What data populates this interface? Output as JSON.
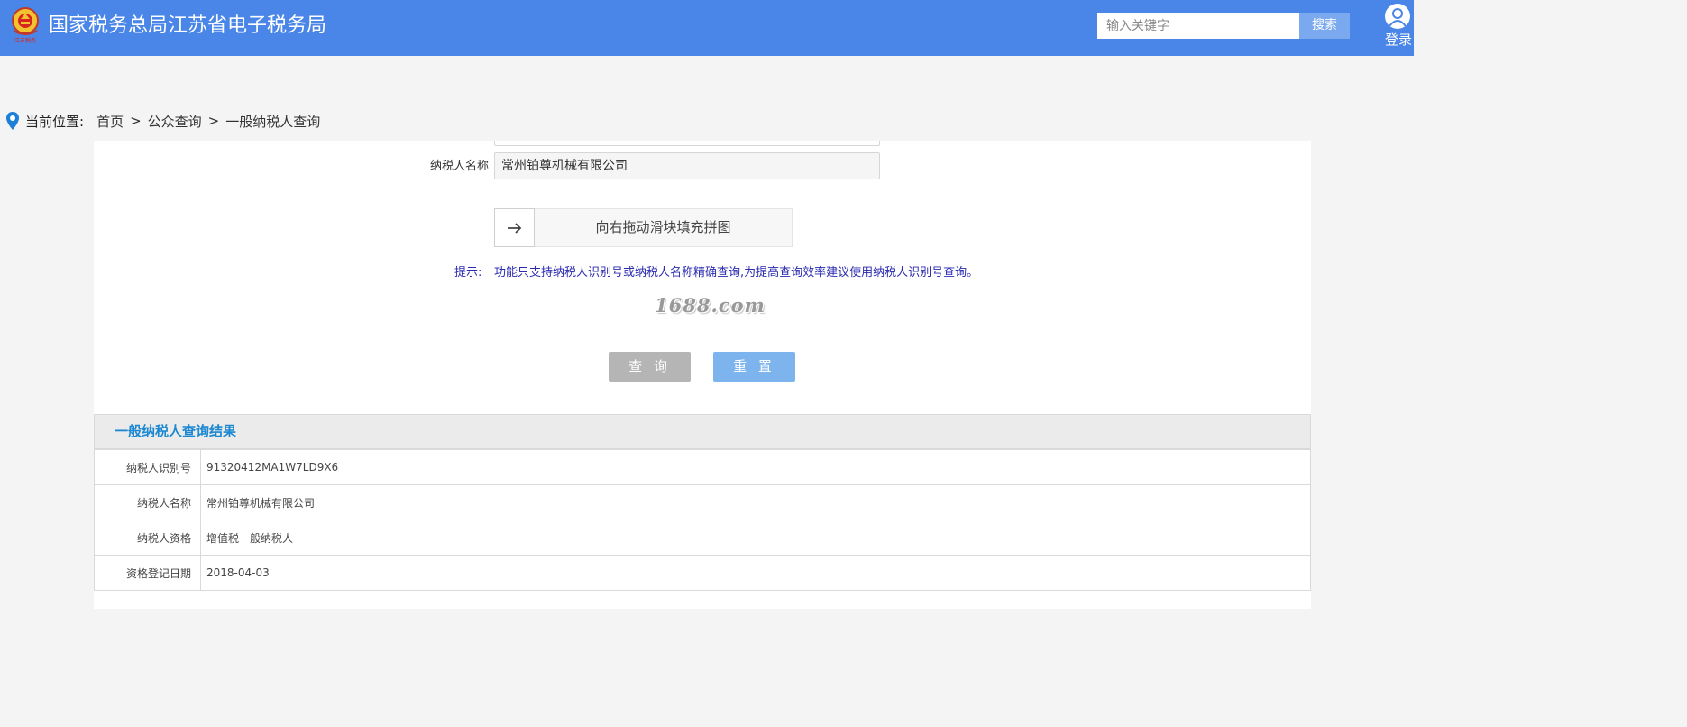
{
  "header": {
    "site_title": "国家税务总局江苏省电子税务局",
    "logo_text": "江苏税务",
    "search_placeholder": "输入关键字",
    "search_button": "搜索",
    "login_label": "登录",
    "bar_color": "#4a86e8"
  },
  "breadcrumb": {
    "lead": "当前位置:",
    "items": [
      "首页",
      "公众查询",
      "一般纳税人查询"
    ],
    "separator": ">"
  },
  "form": {
    "taxpayer_name_label": "纳税人名称",
    "taxpayer_name_value": "常州铂尊机械有限公司",
    "slider_text": "向右拖动滑块填充拼图",
    "tip_label": "提示:",
    "tip_text": "功能只支持纳税人识别号或纳税人名称精确查询,为提高查询效率建议使用纳税人识别号查询。",
    "watermark": "1688.com",
    "query_button": "查 询",
    "reset_button": "重 置"
  },
  "result": {
    "title": "一般纳税人查询结果",
    "rows": [
      {
        "label": "纳税人识别号",
        "value": "91320412MA1W7LD9X6"
      },
      {
        "label": "纳税人名称",
        "value": "常州铂尊机械有限公司"
      },
      {
        "label": "纳税人资格",
        "value": "增值税一般纳税人"
      },
      {
        "label": "资格登记日期",
        "value": "2018-04-03"
      }
    ]
  }
}
